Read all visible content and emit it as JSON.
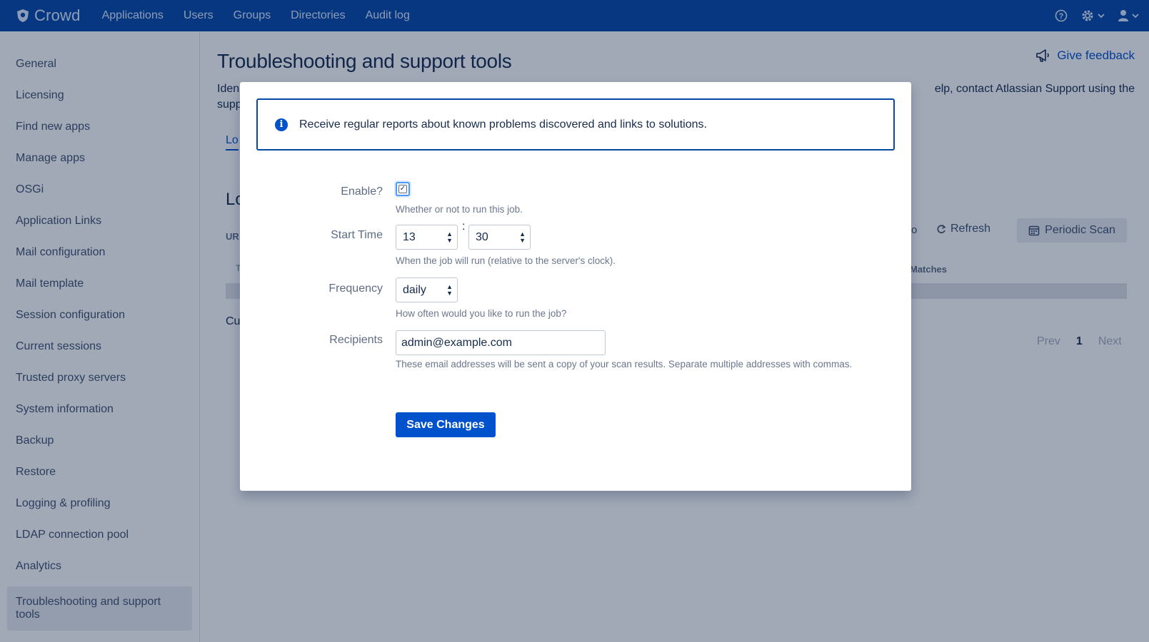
{
  "topbar": {
    "app_name": "Crowd",
    "nav": [
      "Applications",
      "Users",
      "Groups",
      "Directories",
      "Audit log"
    ],
    "icons": [
      "help-icon",
      "gear-icon",
      "user-icon"
    ]
  },
  "sidebar": {
    "items": [
      "General",
      "Licensing",
      "Find new apps",
      "Manage apps",
      "OSGi",
      "Application Links",
      "Mail configuration",
      "Mail template",
      "Session configuration",
      "Current sessions",
      "Trusted proxy servers",
      "System information",
      "Backup",
      "Restore",
      "Logging & profiling",
      "LDAP connection pool",
      "Analytics"
    ],
    "active_item": "Troubleshooting and support tools"
  },
  "page": {
    "title": "Troubleshooting and support tools",
    "feedback": "Give feedback",
    "desc_start": "Iden",
    "desc_start_line2": "supp",
    "desc_end": "elp, contact Atlassian Support using the",
    "tab_fragment": "Lo",
    "heading_fragment": "Lo",
    "url_fragment": "UR",
    "t_fragment": "T",
    "cu_fragment": "Cu",
    "dot_fragment": "o",
    "refresh": "Refresh",
    "periodic_scan": "Periodic Scan",
    "matches": "Matches",
    "pager": {
      "prev": "Prev",
      "current": "1",
      "next": "Next"
    }
  },
  "modal": {
    "info": "Receive regular reports about known problems discovered and links to solutions.",
    "enable_label": "Enable?",
    "enable_checked": true,
    "enable_help": "Whether or not to run this job.",
    "start_time_label": "Start Time",
    "hour": "13",
    "minute": "30",
    "time_separator": ":",
    "start_time_help": "When the job will run (relative to the server's clock).",
    "frequency_label": "Frequency",
    "frequency": "daily",
    "frequency_help": "How often would you like to run the job?",
    "recipients_label": "Recipients",
    "recipients": "admin@example.com",
    "recipients_help": "These email addresses will be sent a copy of your scan results. Separate multiple addresses with commas.",
    "save": "Save Changes"
  },
  "colors": {
    "topbar": "#0747a6",
    "primary": "#0052cc",
    "overlay": "rgba(9,30,66,0.38)"
  }
}
